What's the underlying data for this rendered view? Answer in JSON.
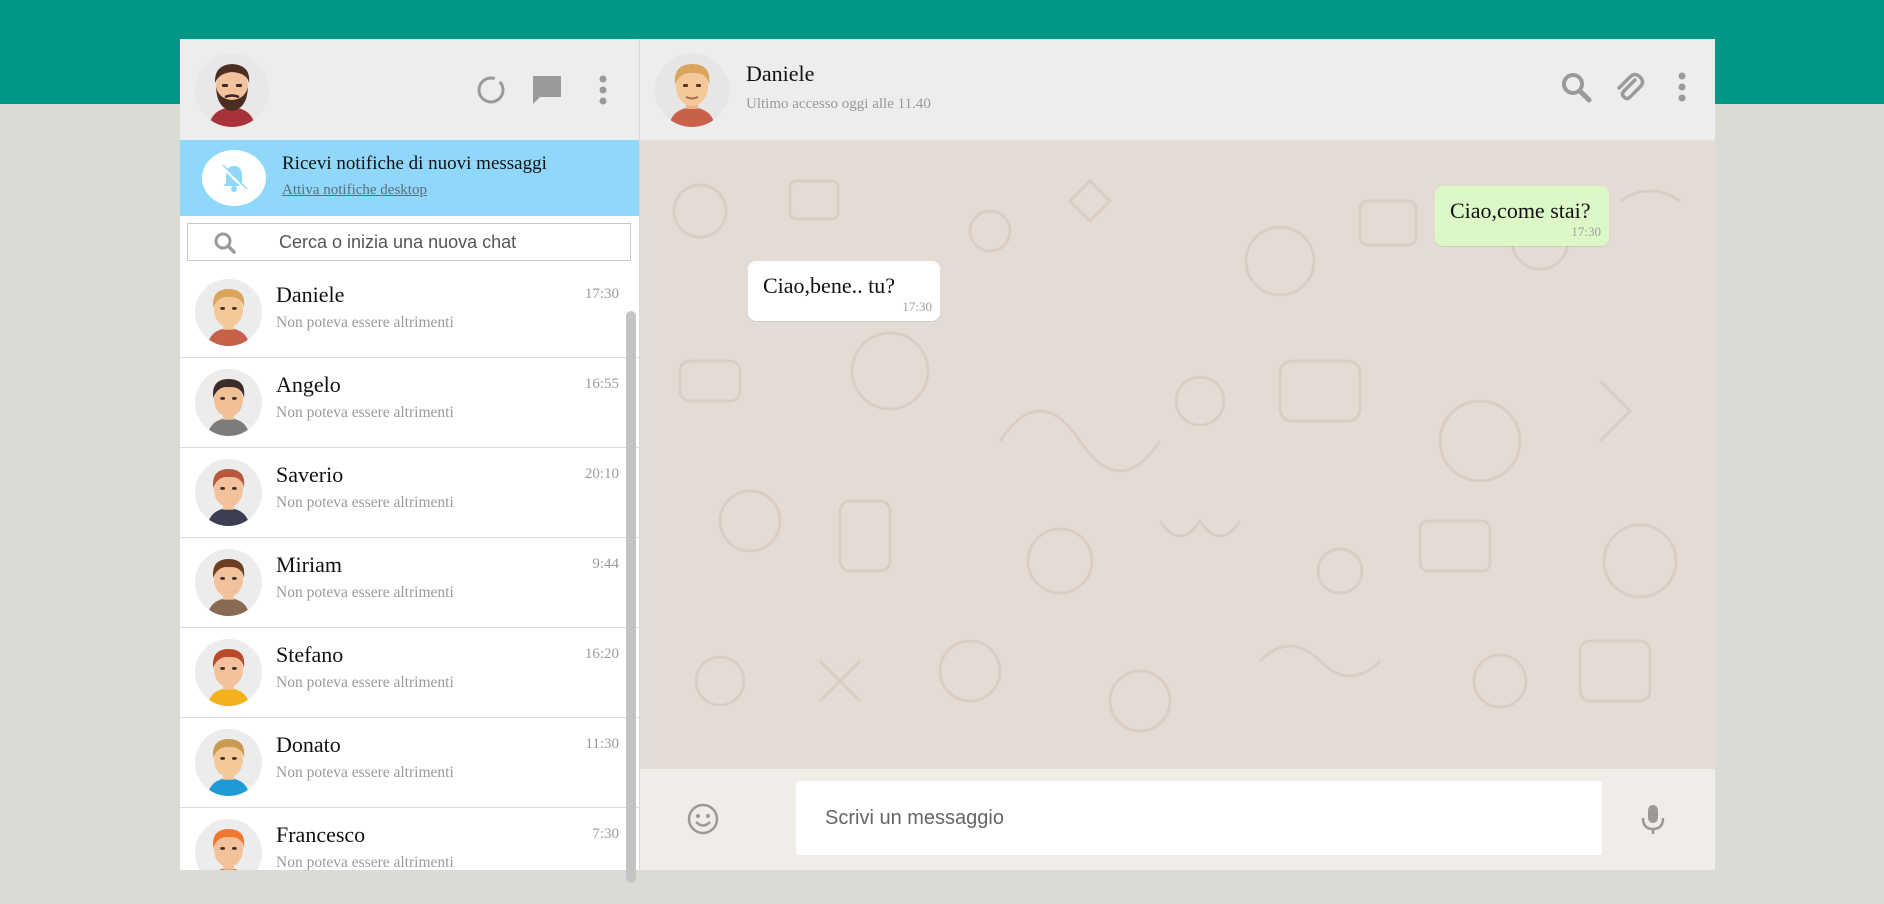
{
  "colors": {
    "brand": "#009688",
    "background": "#dadbd5",
    "notification": "#8fd8fb",
    "sent_bubble": "#dcf8c6",
    "received_bubble": "#ffffff",
    "chat_background": "#e4dcd4"
  },
  "sidebar": {
    "header": {
      "icons": [
        "status-icon",
        "new-chat-icon",
        "menu-icon"
      ]
    },
    "notification": {
      "title": "Ricevi notifiche di nuovi messaggi",
      "link": "Attiva notifiche desktop",
      "icon": "bell-off-icon"
    },
    "search": {
      "placeholder": "Cerca o inizia una nuova chat"
    },
    "chats": [
      {
        "name": "Daniele",
        "time": "17:30",
        "preview": "Non poteva essere altrimenti",
        "hair": "#d9a55b",
        "skin": "#f3c99a",
        "shirt": "#c8604a"
      },
      {
        "name": "Angelo",
        "time": "16:55",
        "preview": "Non poteva essere altrimenti",
        "hair": "#3a2c2a",
        "skin": "#f0c196",
        "shirt": "#7c7c7c"
      },
      {
        "name": "Saverio",
        "time": "20:10",
        "preview": "Non poteva essere altrimenti",
        "hair": "#b5583e",
        "skin": "#f3c29c",
        "shirt": "#3e3e52"
      },
      {
        "name": "Miriam",
        "time": "9:44",
        "preview": "Non poteva essere altrimenti",
        "hair": "#6b3d22",
        "skin": "#f1c29c",
        "shirt": "#8a6a52"
      },
      {
        "name": "Stefano",
        "time": "16:20",
        "preview": "Non poteva essere altrimenti",
        "hair": "#b8492b",
        "skin": "#f3c29c",
        "shirt": "#f2b21c"
      },
      {
        "name": "Donato",
        "time": "11:30",
        "preview": "Non poteva essere altrimenti",
        "hair": "#c99a52",
        "skin": "#f3c99a",
        "shirt": "#1f9ad6"
      },
      {
        "name": "Francesco",
        "time": "7:30",
        "preview": "Non poteva essere altrimenti",
        "hair": "#f07830",
        "skin": "#f3c29c",
        "shirt": "#c85a3a"
      }
    ]
  },
  "conversation": {
    "contact": {
      "name": "Daniele",
      "status": "Ultimo accesso oggi alle 11.40"
    },
    "header_icons": [
      "search-icon",
      "attach-icon",
      "menu-icon"
    ],
    "messages": [
      {
        "direction": "sent",
        "text": "Ciao,come stai?",
        "time": "17:30"
      },
      {
        "direction": "received",
        "text": "Ciao,bene.. tu?",
        "time": "17:30"
      }
    ],
    "input": {
      "placeholder": "Scrivi un messaggio"
    }
  }
}
